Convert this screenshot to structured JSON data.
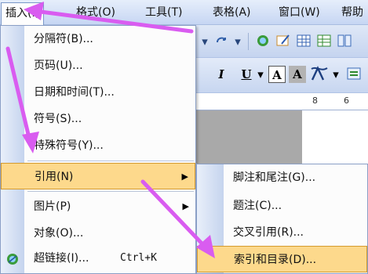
{
  "menubar": {
    "items": [
      {
        "label": "插入(I)"
      },
      {
        "label": "格式(O)"
      },
      {
        "label": "工具(T)"
      },
      {
        "label": "表格(A)"
      },
      {
        "label": "窗口(W)"
      },
      {
        "label": "帮助"
      }
    ]
  },
  "toolbar": {
    "italic": "I",
    "underline": "U",
    "font_color_a": "A",
    "char_shade_a": "A"
  },
  "ruler": {
    "ticks": [
      "8",
      "6"
    ]
  },
  "side_char": ",",
  "insert_menu": {
    "items": [
      {
        "label": "分隔符(B)..."
      },
      {
        "label": "页码(U)..."
      },
      {
        "label": "日期和时间(T)..."
      },
      {
        "label": "符号(S)..."
      },
      {
        "label": "特殊符号(Y)..."
      },
      {
        "label": "引用(N)"
      },
      {
        "label": "图片(P)"
      },
      {
        "label": "对象(O)..."
      },
      {
        "label": "超链接(I)...",
        "shortcut": "Ctrl+K"
      }
    ]
  },
  "reference_submenu": {
    "items": [
      {
        "label": "脚注和尾注(G)..."
      },
      {
        "label": "题注(C)..."
      },
      {
        "label": "交叉引用(R)..."
      },
      {
        "label": "索引和目录(D)..."
      }
    ]
  },
  "colors": {
    "highlight": "#fdd98c",
    "arrow": "#d95cf0"
  }
}
